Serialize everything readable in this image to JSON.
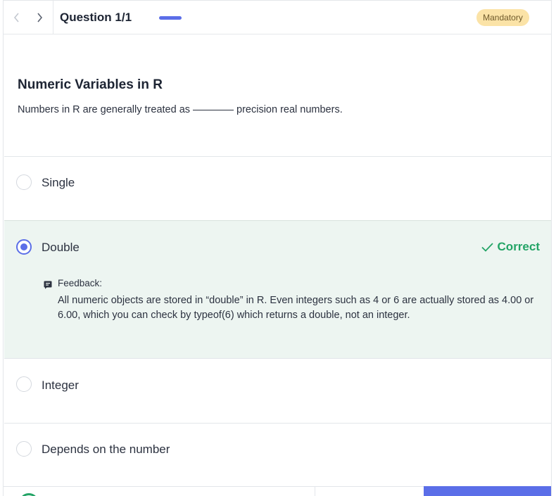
{
  "header": {
    "question_counter": "Question 1/1",
    "badge": "Mandatory",
    "progress_fraction": 1.0
  },
  "question": {
    "title": "Numeric Variables in R",
    "text_before": "Numbers in R are generally treated as",
    "text_after": "precision real numbers."
  },
  "options": [
    {
      "label": "Single",
      "selected": false
    },
    {
      "label": "Double",
      "selected": true,
      "status": "Correct"
    },
    {
      "label": "Integer",
      "selected": false
    },
    {
      "label": "Depends on the number",
      "selected": false
    }
  ],
  "feedback": {
    "label": "Feedback:",
    "text": "All numeric objects are stored in “double” in R. Even integers such as 4 or 6 are actually stored as 4.00 or 6.00, which you can check by typeof(6) which returns a double, not an integer."
  },
  "colors": {
    "accent": "#5b6ee8",
    "correct": "#23a466",
    "badge_bg": "#fbe3a7",
    "correct_bg": "#edf5f1"
  },
  "icons": [
    "chevron-left-icon",
    "chevron-right-icon",
    "check-icon",
    "feedback-icon"
  ]
}
